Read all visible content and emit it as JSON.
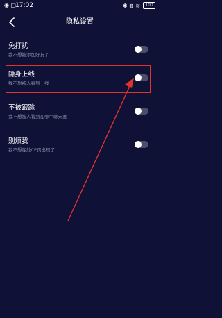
{
  "status_bar": {
    "left_icons": "◉ ▢",
    "time": "17:02",
    "right_icons": "✱ ⊗ ≋",
    "battery": "100"
  },
  "header": {
    "title": "隐私设置"
  },
  "settings": [
    {
      "label": "免打扰",
      "description": "我不想被添加好友了",
      "enabled": false
    },
    {
      "label": "隐身上线",
      "description": "我不想被人看到上线",
      "enabled": false
    },
    {
      "label": "不被跟踪",
      "description": "我不想被人看到在哪个聊天室",
      "enabled": false
    },
    {
      "label": "别烦我",
      "description": "我不想在处CP页出现了",
      "enabled": false
    }
  ],
  "annotation": {
    "highlighted_item": "隐身上线",
    "color": "#e0332b"
  },
  "colors": {
    "background": "#0f1137",
    "toggle_track": "#4b4d69",
    "toggle_knob": "#ffffff",
    "secondary_text": "#8a8ca8"
  }
}
